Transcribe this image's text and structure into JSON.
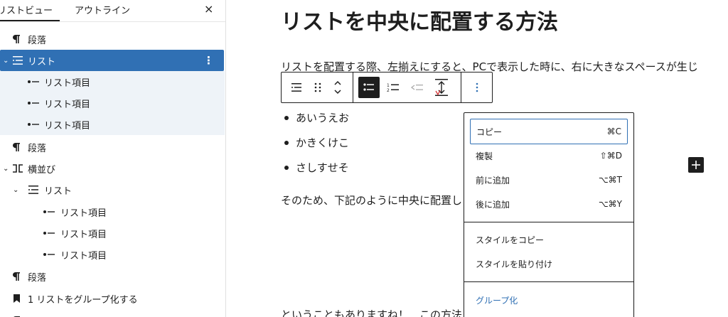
{
  "sidebar": {
    "tabs": [
      {
        "label": "リストビュー"
      },
      {
        "label": "アウトライン"
      }
    ],
    "close_label": "×",
    "tree": [
      {
        "label": "段落"
      },
      {
        "label": "リスト"
      },
      {
        "label": "リスト項目"
      },
      {
        "label": "リスト項目"
      },
      {
        "label": "リスト項目"
      },
      {
        "label": "段落"
      },
      {
        "label": "横並び"
      },
      {
        "label": "リスト"
      },
      {
        "label": "リスト項目"
      },
      {
        "label": "リスト項目"
      },
      {
        "label": "リスト項目"
      },
      {
        "label": "段落"
      },
      {
        "label": "1 リストをグループ化する"
      }
    ]
  },
  "main": {
    "title": "リストを中央に配置する方法",
    "para1": "リストを配置する際、左揃えにすると、PCで表示した時に、右に大きなスペースが生じ",
    "list": [
      "あいうえお",
      "かきくけこ",
      "さしすせそ"
    ],
    "para2": "そのため、下記のように中央に配置し",
    "para3": "ということもありますね！　この方法"
  },
  "menu": {
    "items": [
      {
        "label": "コピー",
        "shortcut": "⌘C"
      },
      {
        "label": "複製",
        "shortcut": "⇧⌘D"
      },
      {
        "label": "前に追加",
        "shortcut": "⌥⌘T"
      },
      {
        "label": "後に追加",
        "shortcut": "⌥⌘Y"
      },
      {
        "label": "スタイルをコピー",
        "shortcut": ""
      },
      {
        "label": "スタイルを貼り付け",
        "shortcut": ""
      },
      {
        "label": "グループ化",
        "shortcut": ""
      }
    ]
  },
  "colors": {
    "accent": "#3070b4",
    "text": "#1e1e1e"
  }
}
